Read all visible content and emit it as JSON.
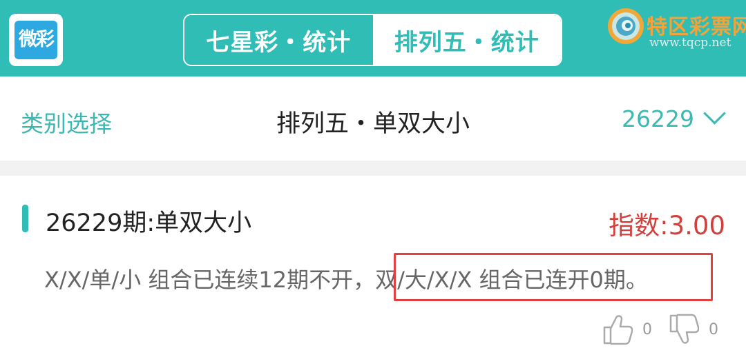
{
  "header": {
    "logo_text": "微彩",
    "tabs": [
      {
        "label": "七星彩・统计",
        "active": false
      },
      {
        "label": "排列五・统计",
        "active": true
      }
    ],
    "brand_name": "特区彩票网",
    "brand_url": "www.tqcp.net"
  },
  "selector": {
    "category_label": "类别选择",
    "title": "排列五・单双大小",
    "issue": "26229"
  },
  "card": {
    "title": "26229期:单双大小",
    "index": "指数:3.00",
    "desc_part1": "X/X/单/小 组合已连续12期不开，",
    "desc_part2": "双/大/X/X 组合已连开0期。",
    "likes": "0",
    "dislikes": "0"
  },
  "colors": {
    "primary": "#2fbdb6",
    "index": "#d0413e",
    "highlight_border": "#e2423f"
  }
}
